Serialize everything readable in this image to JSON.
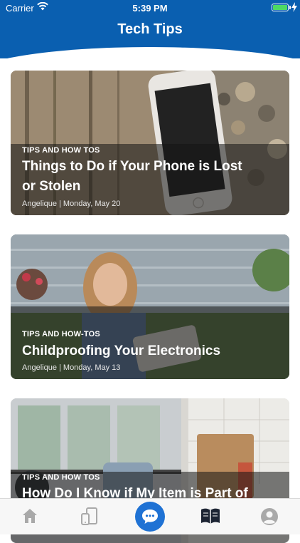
{
  "status_bar": {
    "carrier": "Carrier",
    "time": "5:39 PM"
  },
  "header": {
    "title": "Tech Tips"
  },
  "articles": [
    {
      "category": "TIPS AND HOW TOS",
      "title_line1": "Things to Do if Your Phone is Lost",
      "title_line2": "or Stolen",
      "meta": "Angelique | Monday, May 20"
    },
    {
      "category": "TIPS AND HOW-TOS",
      "title_line1": "Childproofing Your Electronics",
      "title_line2": "",
      "meta": "Angelique | Monday, May 13"
    },
    {
      "category": "TIPS AND HOW TOS",
      "title_line1": "How Do I Know if My Item is Part of",
      "title_line2": "",
      "meta": ""
    }
  ],
  "tabbar": {
    "items": [
      {
        "icon": "home-icon"
      },
      {
        "icon": "devices-icon"
      },
      {
        "icon": "chat-icon"
      },
      {
        "icon": "book-icon"
      },
      {
        "icon": "profile-icon"
      }
    ]
  },
  "colors": {
    "brand": "#0a5fb0",
    "accent": "#1f72d4",
    "battery": "#4cd964"
  }
}
